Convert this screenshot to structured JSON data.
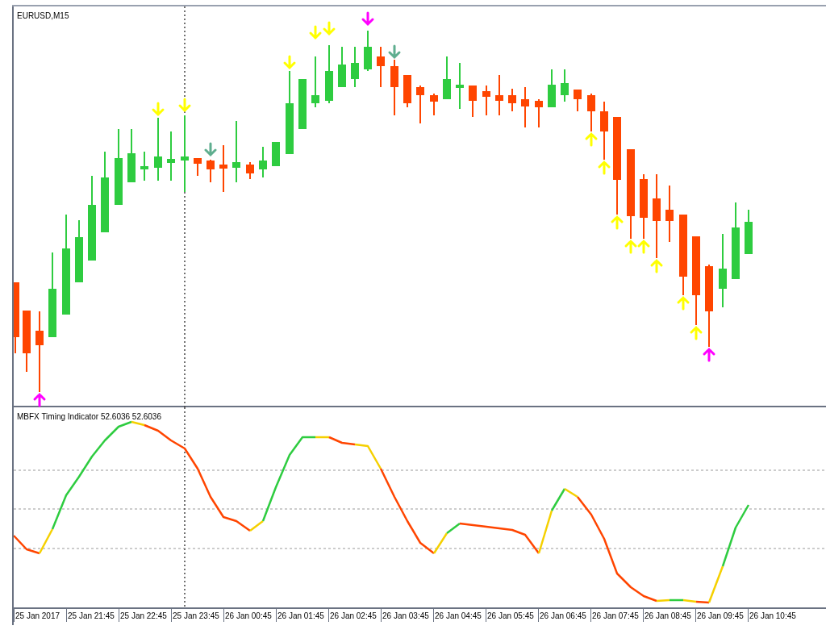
{
  "chart": {
    "title": "EURUSD,M15"
  },
  "indicator": {
    "label": "MBFX Timing Indicator 52.6036 52.6036"
  },
  "time_axis": {
    "labels": [
      "25 Jan 2017",
      "25 Jan 21:45",
      "25 Jan 22:45",
      "25 Jan 23:45",
      "26 Jan 00:45",
      "26 Jan 01:45",
      "26 Jan 02:45",
      "26 Jan 03:45",
      "26 Jan 04:45",
      "26 Jan 05:45",
      "26 Jan 06:45",
      "26 Jan 07:45",
      "26 Jan 08:45",
      "26 Jan 09:45",
      "26 Jan 10:45"
    ]
  }
}
